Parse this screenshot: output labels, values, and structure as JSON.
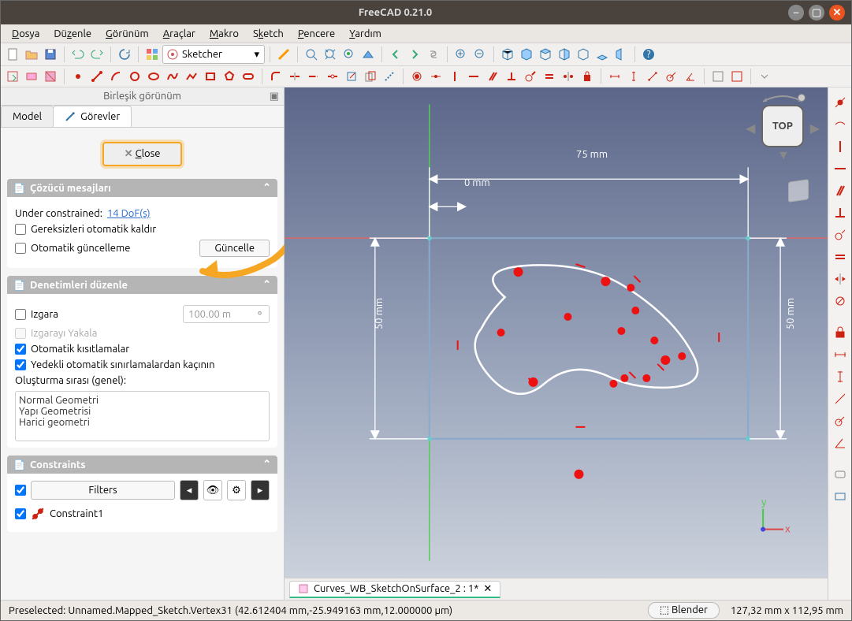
{
  "window": {
    "title": "FreeCAD 0.21.0"
  },
  "menu": {
    "items": [
      "Dosya",
      "Düzenle",
      "Görünüm",
      "Araçlar",
      "Makro",
      "Sketch",
      "Pencere",
      "Yardım"
    ]
  },
  "workbench": {
    "selected": "Sketcher"
  },
  "combo": {
    "header": "Birleşik görünüm"
  },
  "tabs": {
    "model": "Model",
    "tasks": "Görevler"
  },
  "task": {
    "close_label": "Close"
  },
  "solver": {
    "title": "Çözücü mesajları",
    "under_constrained_label": "Under constrained:",
    "dof_link": "14 DoF(s)",
    "auto_remove": "Gereksizleri otomatik kaldır",
    "auto_update": "Otomatik güncelleme",
    "update_btn": "Güncelle"
  },
  "edit_controls": {
    "title": "Denetimleri düzenle",
    "grid": "Izgara",
    "grid_value": "100.00 m",
    "snap": "Izgarayı Yakala",
    "auto_constraints": "Otomatik kısıtlamalar",
    "avoid_redundant": "Yedekli otomatik sınırlamalardan kaçının",
    "render_order": "Oluşturma sırası (genel):",
    "order_items": [
      "Normal Geometri",
      "Yapı Geometrisi",
      "Harici geometri"
    ]
  },
  "constraints": {
    "title": "Constraints",
    "filters": "Filters",
    "item1": "Constraint1"
  },
  "viewport": {
    "cube_face": "TOP",
    "dim_top": "75 mm",
    "dim_top2": "0 mm",
    "dim_left": "50 mm",
    "dim_right": "50 mm"
  },
  "doc_tab": {
    "label": "Curves_WB_SketchOnSurface_2 : 1*"
  },
  "status": {
    "preselect": "Preselected: Unnamed.Mapped_Sketch.Vertex31 (42.612404 mm,-25.949163 mm,12.000000 µm)",
    "blender": "Blender",
    "coords": "127,32 mm x 112,95 mm"
  },
  "colors": {
    "accent": "#e95420",
    "annot": "#f5a623",
    "constraint": "#c21"
  }
}
